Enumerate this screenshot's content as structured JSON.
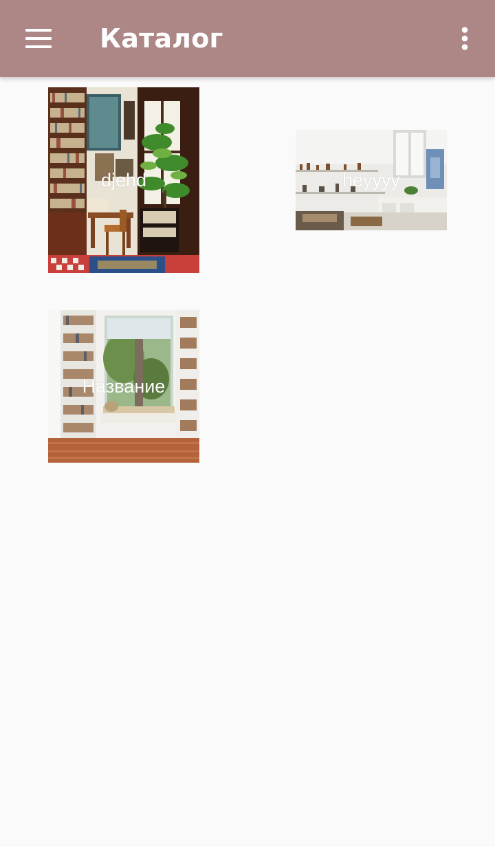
{
  "app_bar": {
    "title": "Каталог",
    "background_color": "#ac8785",
    "menu_icon": "hamburger-menu-icon",
    "overflow_icon": "more-vertical-icon"
  },
  "catalog": {
    "items": [
      {
        "title": "djehd",
        "image": "library-study-room-photo"
      },
      {
        "title": "heyyyy",
        "image": "bright-kitchen-room-photo"
      },
      {
        "title": "Название",
        "image": "window-reading-nook-photo"
      }
    ]
  }
}
